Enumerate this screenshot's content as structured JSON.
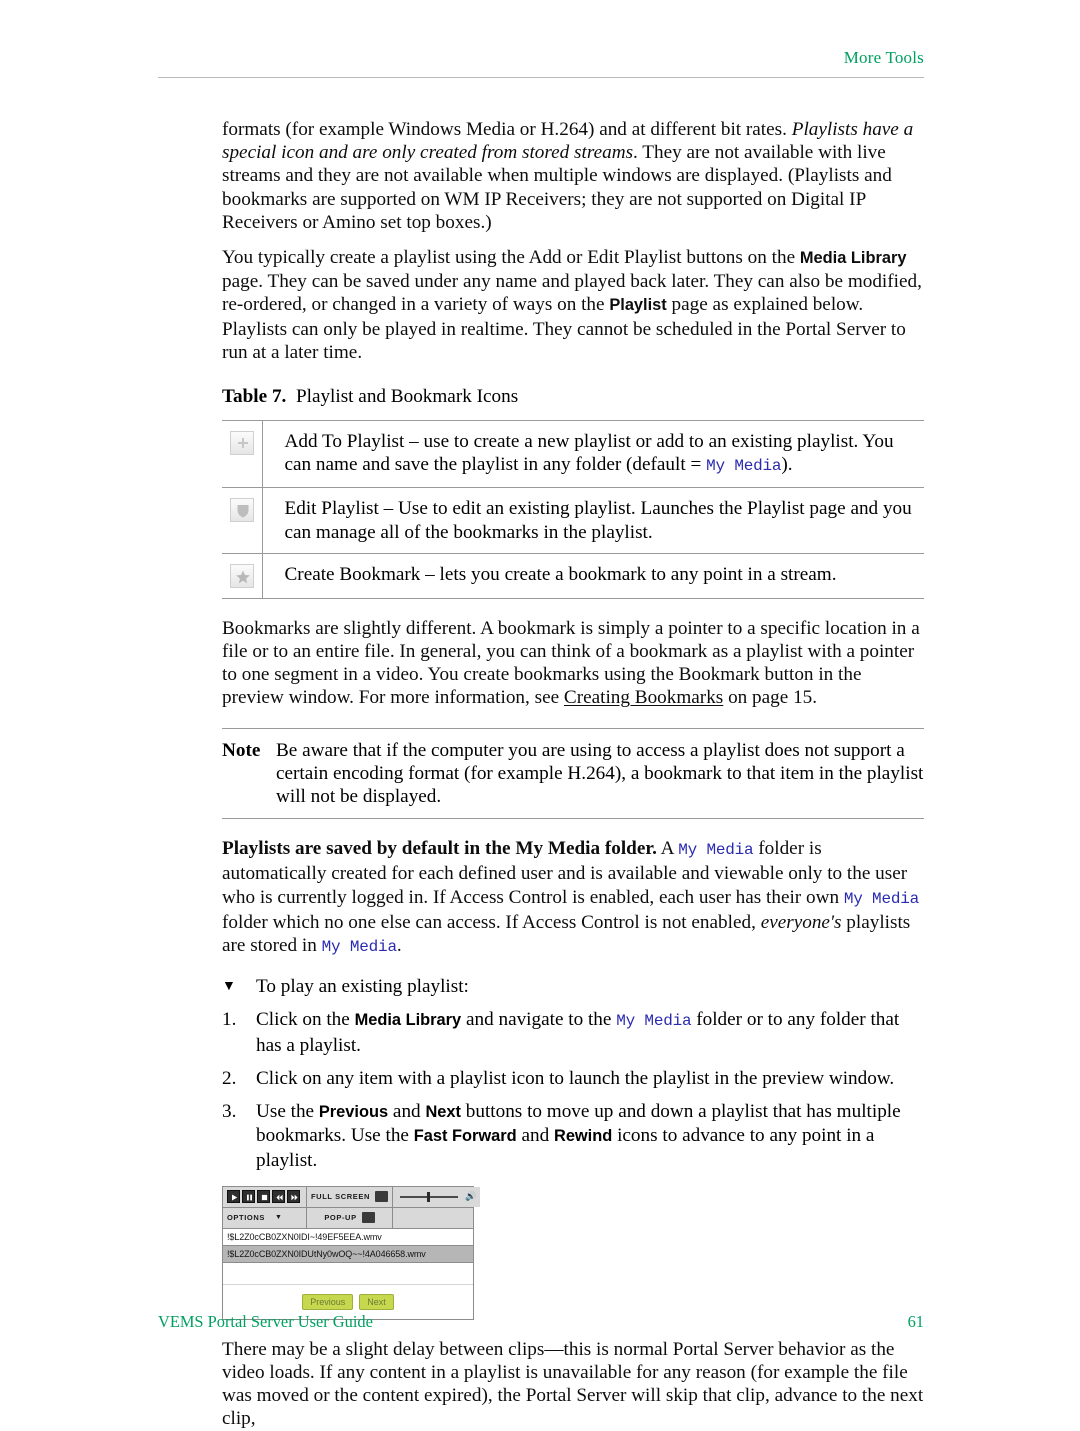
{
  "header": {
    "running_head": "More Tools"
  },
  "footer": {
    "guide_title": "VEMS Portal Server User Guide",
    "page_number": "61"
  },
  "paragraphs": {
    "p1_a": "formats (for example Windows Media or H.264) and at different bit rates. ",
    "p1_em": "Playlists have a special icon and are only created from stored streams",
    "p1_b": ". They are not available with live streams and they are not available when multiple windows are displayed. (Playlists and bookmarks are supported on WM IP Receivers; they are not supported on Digital IP Receivers or Amino set top boxes.)",
    "p2_a": "You typically create a playlist using the Add or Edit Playlist buttons on the ",
    "p2_bold1": "Media Library",
    "p2_b": " page. They can be saved under any name and played back later. They can also be modified, re-ordered, or changed in a variety of ways on the ",
    "p2_bold2": "Playlist",
    "p2_c": " page as explained below. Playlists can only be played in realtime. They cannot be scheduled in the Portal Server to run at a later time.",
    "p3_a": "Bookmarks are slightly different. A bookmark is simply a pointer to a specific location in a file or to an entire file. In general, you can think of a bookmark as a playlist with a pointer to one segment in a video. You create bookmarks using the Bookmark button in the preview window. For more information, see ",
    "p3_link": "Creating Bookmarks",
    "p3_b": " on page 15.",
    "p5_bold": "Playlists are saved by default in the My Media folder.",
    "p5_a": " A ",
    "p5_code1": "My Media",
    "p5_b": " folder is automatically created for each defined user and is available and viewable only to the user who is currently logged in. If Access Control is enabled, each user has their own ",
    "p5_code2": "My Media",
    "p5_c": " folder which no one else can access. If Access Control is not enabled, ",
    "p5_em": "everyone's",
    "p5_d": " playlists are stored in ",
    "p5_code3": "My Media",
    "p5_e": ".",
    "p6": "There may be a slight delay between clips—this is normal Portal Server behavior as the video loads. If any content in a playlist is unavailable for any reason (for example the file was moved or the content expired), the Portal Server will skip that clip, advance to the next clip,"
  },
  "table": {
    "caption_label": "Table 7.",
    "caption_text": "Playlist and Bookmark Icons",
    "rows": [
      {
        "icon": "plus-icon",
        "text_a": "Add To Playlist – use to create a new playlist or add to an existing playlist. You can name and save the playlist in any folder (default = ",
        "code": "My Media",
        "text_b": ")."
      },
      {
        "icon": "shield-icon",
        "text_a": "Edit Playlist – Use to edit an existing playlist. Launches the Playlist page and you can manage all of the bookmarks in the playlist.",
        "code": "",
        "text_b": ""
      },
      {
        "icon": "star-icon",
        "text_a": "Create Bookmark – lets you create a bookmark to any point in a stream.",
        "code": "",
        "text_b": ""
      }
    ]
  },
  "note": {
    "label": "Note",
    "text": "Be aware that if the computer you are using to access a playlist does not support a certain encoding format (for example H.264), a bookmark to that item in the playlist will not be displayed."
  },
  "procedure": {
    "marker": "▼",
    "heading": "To play an existing playlist:",
    "steps": [
      {
        "num": "1.",
        "a": "Click on the ",
        "bold1": "Media Library",
        "b": " and navigate to the ",
        "code1": "My Media",
        "c": " folder or to any folder that has a playlist.",
        "bold2": "",
        "d": ""
      },
      {
        "num": "2.",
        "a": "Click on any item with a playlist icon to launch the playlist in the preview window.",
        "bold1": "",
        "b": "",
        "code1": "",
        "c": "",
        "bold2": "",
        "d": ""
      },
      {
        "num": "3.",
        "a": "Use the ",
        "bold1": "Previous",
        "b": " and ",
        "bold2": "Next",
        "c": " buttons to move up and down a playlist that has multiple bookmarks. Use the ",
        "bold3": "Fast Forward",
        "d": " and ",
        "bold4": "Rewind",
        "e": " icons to advance to any point in a playlist."
      }
    ]
  },
  "player_screenshot": {
    "transport_buttons": [
      "play-icon",
      "pause-icon",
      "stop-icon",
      "rewind-icon",
      "fast-forward-icon"
    ],
    "full_screen_label": "FULL SCREEN",
    "options_label": "OPTIONS",
    "options_caret": "▼",
    "popup_label": "POP-UP",
    "volume_icon": "speaker-icon",
    "files": [
      "!$L2Z0cCB0ZXN0IDI~!49EF5EEA.wmv",
      "!$L2Z0cCB0ZXN0IDUtNy0wOQ~~!4A046658.wmv"
    ],
    "selected_file_index": 1,
    "previous_label": "Previous",
    "next_label": "Next"
  },
  "colors": {
    "accent_green": "#00a060",
    "code_blue": "#2a2ab0",
    "button_green": "#c5d84e",
    "rule_gray": "#9a9a9a"
  }
}
